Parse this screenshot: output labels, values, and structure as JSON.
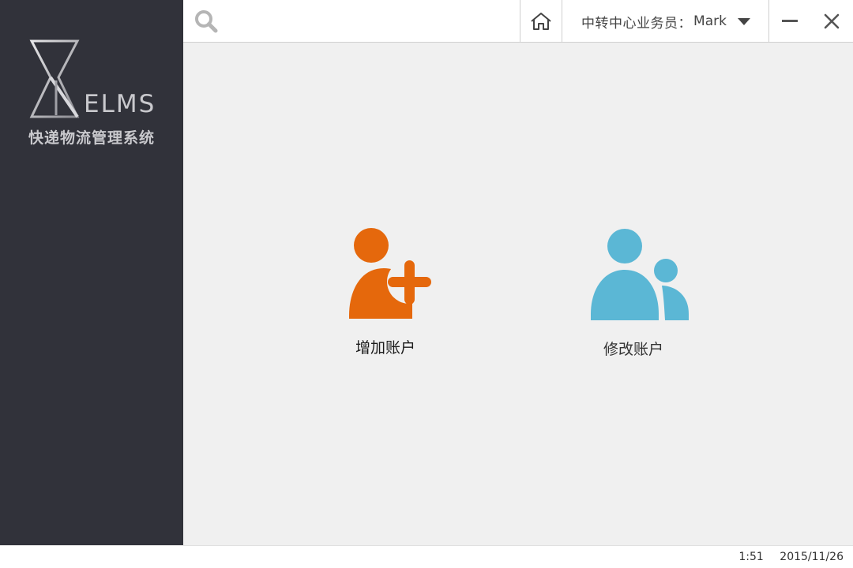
{
  "app": {
    "logo_text": "ELMS",
    "subtitle": "快递物流管理系统"
  },
  "search": {
    "placeholder": "",
    "icon": "search-icon"
  },
  "header": {
    "home_icon": "home-icon",
    "user_role_label": "中转中心业务员：",
    "user_name": "Mark",
    "dropdown_icon": "caret-down-icon",
    "minimize_icon": "minimize-icon",
    "close_icon": "close-icon"
  },
  "actions": [
    {
      "label": "增加账户",
      "icon": "add-user-icon",
      "color": "#e5680c"
    },
    {
      "label": "修改账户",
      "icon": "users-icon",
      "color": "#5bb7d5"
    }
  ],
  "status": {
    "time": "1:51",
    "date": "2015/11/26"
  },
  "colors": {
    "sidebar_bg": "#31323a",
    "content_bg": "#f0f0f0",
    "accent_orange": "#e5680c",
    "accent_blue": "#5bb7d5"
  }
}
